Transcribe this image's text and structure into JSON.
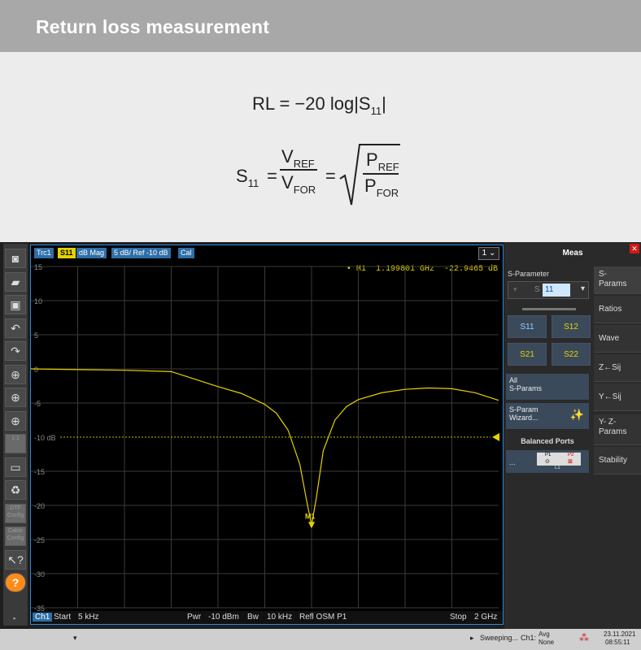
{
  "header": {
    "title": "Return loss measurement"
  },
  "formula": {
    "rl": {
      "lhs": "RL",
      "eq": "=",
      "rhs": "−20 log|S",
      "sub": "11",
      "end": "|"
    },
    "s11": {
      "lhs": "S",
      "lhs_sub": "11",
      "eq1": "=",
      "num": "V",
      "num_sub": "REF",
      "den": "V",
      "den_sub": "FOR",
      "eq2": "=",
      "rnum": "P",
      "rnum_sub": "REF",
      "rden": "P",
      "rden_sub": "FOR"
    }
  },
  "trace_bar": {
    "trc": "Trc1",
    "param": "S11",
    "format": "dB Mag",
    "scale": "5 dB/ Ref -10 dB",
    "cal": "Cal",
    "channel_select": "1"
  },
  "marker": {
    "label": "• M1",
    "freq": "1.199801 GHz",
    "value": "-22.9465 dB",
    "name": "M1"
  },
  "ref_label": "-10 dB",
  "status": {
    "ch": "Ch1",
    "start_label": "Start",
    "start": "5 kHz",
    "pwr_label": "Pwr",
    "pwr": "-10 dBm",
    "bw_label": "Bw",
    "bw": "10 kHz",
    "refl": "Refl OSM P1",
    "stop_label": "Stop",
    "stop": "2 GHz"
  },
  "chart_data": {
    "type": "line",
    "ylim": [
      -35,
      15
    ],
    "y_ticks": [
      "15",
      "10",
      "5",
      "0",
      "-5",
      "-10 dB",
      "-15",
      "-20",
      "-25",
      "-30",
      "-35"
    ],
    "xlim_ghz": [
      5e-06,
      2
    ],
    "series": [
      {
        "x_ghz": [
          0.0,
          0.2,
          0.4,
          0.6,
          0.7,
          0.8,
          0.9,
          1.0,
          1.05,
          1.1,
          1.15,
          1.18,
          1.2,
          1.22,
          1.25,
          1.3,
          1.35,
          1.4,
          1.5,
          1.6,
          1.7,
          1.8,
          1.9,
          2.0
        ],
        "y_db": [
          0.0,
          -0.1,
          -0.2,
          -0.4,
          -1.5,
          -2.6,
          -3.6,
          -5.2,
          -6.5,
          -9.0,
          -14.0,
          -19.5,
          -22.9,
          -19.0,
          -12.0,
          -7.5,
          -5.5,
          -4.5,
          -3.5,
          -3.0,
          -2.8,
          -2.9,
          -3.5,
          -4.6
        ]
      }
    ]
  },
  "toolbar": {
    "items": [
      {
        "name": "camera-icon",
        "glyph": "◙"
      },
      {
        "name": "open-folder-icon",
        "glyph": "▰"
      },
      {
        "name": "save-icon",
        "glyph": "▣"
      },
      {
        "name": "undo-icon",
        "glyph": "↶"
      },
      {
        "name": "redo-icon",
        "glyph": "↷"
      },
      {
        "name": "zoom-icon-1",
        "glyph": "⊕"
      },
      {
        "name": "zoom-icon-2",
        "glyph": "⊕"
      },
      {
        "name": "zoom-icon-3",
        "glyph": "⊕"
      },
      {
        "name": "zoom-1to1-icon",
        "glyph": "1:1"
      },
      {
        "name": "fullscreen-icon",
        "glyph": "▭"
      },
      {
        "name": "recycle-icon",
        "glyph": "♻"
      },
      {
        "name": "dtf-config-icon",
        "glyph": "DTF Config"
      },
      {
        "name": "cable-config-icon",
        "glyph": "Cable Config"
      },
      {
        "name": "help-pointer-icon",
        "glyph": "↖?"
      },
      {
        "name": "help-icon",
        "glyph": "?"
      }
    ]
  },
  "meas_panel": {
    "title": "Meas",
    "s_param_label": "S-Parameter",
    "s_select": "S",
    "s_value": "11",
    "buttons": [
      "S11",
      "S12",
      "S21",
      "S22"
    ],
    "all": "All\nS-Params",
    "wizard": "S-Param\nWizard...",
    "balanced": "Balanced Ports",
    "tabs": [
      "S-\nParams",
      "Ratios",
      "Wave",
      "Z←Sij",
      "Y←Sij",
      "Y- Z-\nParams",
      "Stability"
    ],
    "p1": "P1",
    "p2": "P2",
    "l1": "L1"
  },
  "bottom": {
    "sweep": "Sweeping...",
    "ch": "Ch1:",
    "avg": "Avg",
    "none": "None",
    "date": "23.11.2021",
    "time": "08:55:11"
  }
}
